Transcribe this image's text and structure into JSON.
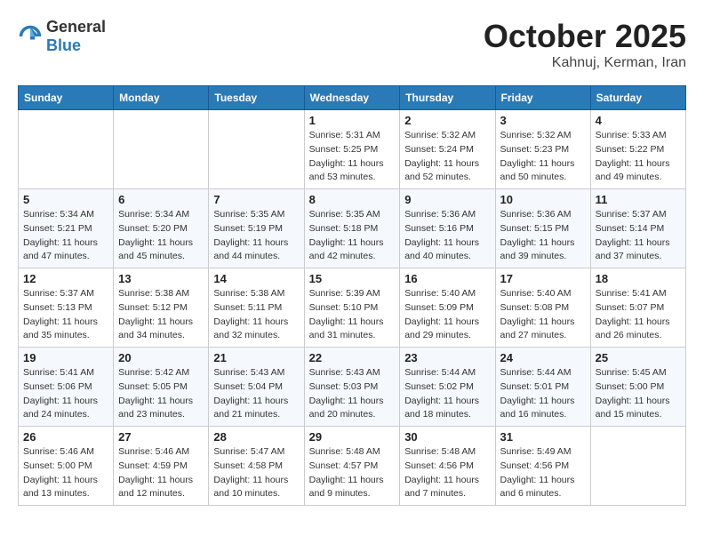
{
  "header": {
    "logo_general": "General",
    "logo_blue": "Blue",
    "month": "October 2025",
    "location": "Kahnuj, Kerman, Iran"
  },
  "weekdays": [
    "Sunday",
    "Monday",
    "Tuesday",
    "Wednesday",
    "Thursday",
    "Friday",
    "Saturday"
  ],
  "weeks": [
    [
      {
        "day": "",
        "sunrise": "",
        "sunset": "",
        "daylight": ""
      },
      {
        "day": "",
        "sunrise": "",
        "sunset": "",
        "daylight": ""
      },
      {
        "day": "",
        "sunrise": "",
        "sunset": "",
        "daylight": ""
      },
      {
        "day": "1",
        "sunrise": "Sunrise: 5:31 AM",
        "sunset": "Sunset: 5:25 PM",
        "daylight": "Daylight: 11 hours and 53 minutes."
      },
      {
        "day": "2",
        "sunrise": "Sunrise: 5:32 AM",
        "sunset": "Sunset: 5:24 PM",
        "daylight": "Daylight: 11 hours and 52 minutes."
      },
      {
        "day": "3",
        "sunrise": "Sunrise: 5:32 AM",
        "sunset": "Sunset: 5:23 PM",
        "daylight": "Daylight: 11 hours and 50 minutes."
      },
      {
        "day": "4",
        "sunrise": "Sunrise: 5:33 AM",
        "sunset": "Sunset: 5:22 PM",
        "daylight": "Daylight: 11 hours and 49 minutes."
      }
    ],
    [
      {
        "day": "5",
        "sunrise": "Sunrise: 5:34 AM",
        "sunset": "Sunset: 5:21 PM",
        "daylight": "Daylight: 11 hours and 47 minutes."
      },
      {
        "day": "6",
        "sunrise": "Sunrise: 5:34 AM",
        "sunset": "Sunset: 5:20 PM",
        "daylight": "Daylight: 11 hours and 45 minutes."
      },
      {
        "day": "7",
        "sunrise": "Sunrise: 5:35 AM",
        "sunset": "Sunset: 5:19 PM",
        "daylight": "Daylight: 11 hours and 44 minutes."
      },
      {
        "day": "8",
        "sunrise": "Sunrise: 5:35 AM",
        "sunset": "Sunset: 5:18 PM",
        "daylight": "Daylight: 11 hours and 42 minutes."
      },
      {
        "day": "9",
        "sunrise": "Sunrise: 5:36 AM",
        "sunset": "Sunset: 5:16 PM",
        "daylight": "Daylight: 11 hours and 40 minutes."
      },
      {
        "day": "10",
        "sunrise": "Sunrise: 5:36 AM",
        "sunset": "Sunset: 5:15 PM",
        "daylight": "Daylight: 11 hours and 39 minutes."
      },
      {
        "day": "11",
        "sunrise": "Sunrise: 5:37 AM",
        "sunset": "Sunset: 5:14 PM",
        "daylight": "Daylight: 11 hours and 37 minutes."
      }
    ],
    [
      {
        "day": "12",
        "sunrise": "Sunrise: 5:37 AM",
        "sunset": "Sunset: 5:13 PM",
        "daylight": "Daylight: 11 hours and 35 minutes."
      },
      {
        "day": "13",
        "sunrise": "Sunrise: 5:38 AM",
        "sunset": "Sunset: 5:12 PM",
        "daylight": "Daylight: 11 hours and 34 minutes."
      },
      {
        "day": "14",
        "sunrise": "Sunrise: 5:38 AM",
        "sunset": "Sunset: 5:11 PM",
        "daylight": "Daylight: 11 hours and 32 minutes."
      },
      {
        "day": "15",
        "sunrise": "Sunrise: 5:39 AM",
        "sunset": "Sunset: 5:10 PM",
        "daylight": "Daylight: 11 hours and 31 minutes."
      },
      {
        "day": "16",
        "sunrise": "Sunrise: 5:40 AM",
        "sunset": "Sunset: 5:09 PM",
        "daylight": "Daylight: 11 hours and 29 minutes."
      },
      {
        "day": "17",
        "sunrise": "Sunrise: 5:40 AM",
        "sunset": "Sunset: 5:08 PM",
        "daylight": "Daylight: 11 hours and 27 minutes."
      },
      {
        "day": "18",
        "sunrise": "Sunrise: 5:41 AM",
        "sunset": "Sunset: 5:07 PM",
        "daylight": "Daylight: 11 hours and 26 minutes."
      }
    ],
    [
      {
        "day": "19",
        "sunrise": "Sunrise: 5:41 AM",
        "sunset": "Sunset: 5:06 PM",
        "daylight": "Daylight: 11 hours and 24 minutes."
      },
      {
        "day": "20",
        "sunrise": "Sunrise: 5:42 AM",
        "sunset": "Sunset: 5:05 PM",
        "daylight": "Daylight: 11 hours and 23 minutes."
      },
      {
        "day": "21",
        "sunrise": "Sunrise: 5:43 AM",
        "sunset": "Sunset: 5:04 PM",
        "daylight": "Daylight: 11 hours and 21 minutes."
      },
      {
        "day": "22",
        "sunrise": "Sunrise: 5:43 AM",
        "sunset": "Sunset: 5:03 PM",
        "daylight": "Daylight: 11 hours and 20 minutes."
      },
      {
        "day": "23",
        "sunrise": "Sunrise: 5:44 AM",
        "sunset": "Sunset: 5:02 PM",
        "daylight": "Daylight: 11 hours and 18 minutes."
      },
      {
        "day": "24",
        "sunrise": "Sunrise: 5:44 AM",
        "sunset": "Sunset: 5:01 PM",
        "daylight": "Daylight: 11 hours and 16 minutes."
      },
      {
        "day": "25",
        "sunrise": "Sunrise: 5:45 AM",
        "sunset": "Sunset: 5:00 PM",
        "daylight": "Daylight: 11 hours and 15 minutes."
      }
    ],
    [
      {
        "day": "26",
        "sunrise": "Sunrise: 5:46 AM",
        "sunset": "Sunset: 5:00 PM",
        "daylight": "Daylight: 11 hours and 13 minutes."
      },
      {
        "day": "27",
        "sunrise": "Sunrise: 5:46 AM",
        "sunset": "Sunset: 4:59 PM",
        "daylight": "Daylight: 11 hours and 12 minutes."
      },
      {
        "day": "28",
        "sunrise": "Sunrise: 5:47 AM",
        "sunset": "Sunset: 4:58 PM",
        "daylight": "Daylight: 11 hours and 10 minutes."
      },
      {
        "day": "29",
        "sunrise": "Sunrise: 5:48 AM",
        "sunset": "Sunset: 4:57 PM",
        "daylight": "Daylight: 11 hours and 9 minutes."
      },
      {
        "day": "30",
        "sunrise": "Sunrise: 5:48 AM",
        "sunset": "Sunset: 4:56 PM",
        "daylight": "Daylight: 11 hours and 7 minutes."
      },
      {
        "day": "31",
        "sunrise": "Sunrise: 5:49 AM",
        "sunset": "Sunset: 4:56 PM",
        "daylight": "Daylight: 11 hours and 6 minutes."
      },
      {
        "day": "",
        "sunrise": "",
        "sunset": "",
        "daylight": ""
      }
    ]
  ]
}
